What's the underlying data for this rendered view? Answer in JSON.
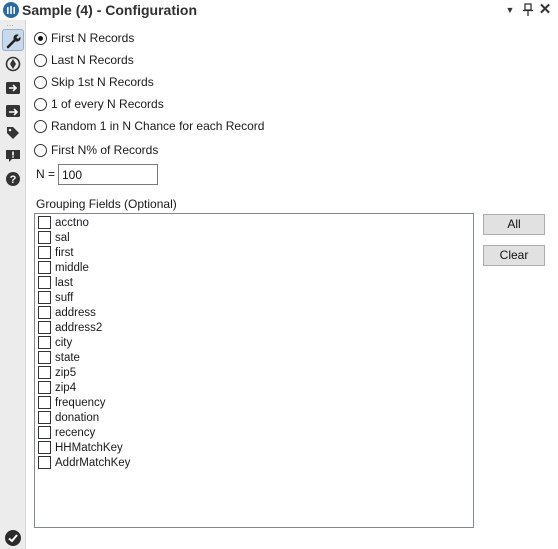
{
  "window": {
    "title": "Sample (4) - Configuration",
    "controls": {
      "dropdown": "▼",
      "pin": "📌",
      "close": "✕"
    }
  },
  "rail": {
    "icons": [
      "wrench-icon",
      "tool-navigate-icon",
      "input-arrow-icon",
      "output-arrow-icon",
      "tag-icon",
      "alert-icon",
      "help-icon"
    ],
    "status_icon": "checkmark-icon"
  },
  "sampling": {
    "options": [
      {
        "label": "First N Records",
        "checked": true
      },
      {
        "label": "Last N Records",
        "checked": false
      },
      {
        "label": "Skip 1st N Records",
        "checked": false
      },
      {
        "label": "1 of every N Records",
        "checked": false
      },
      {
        "label": "Random 1 in N Chance for each Record",
        "checked": false
      },
      {
        "label": "First N% of Records",
        "checked": false
      }
    ],
    "n_label": "N =",
    "n_value": "100"
  },
  "grouping": {
    "label": "Grouping Fields (Optional)",
    "fields": [
      {
        "name": "acctno",
        "checked": false
      },
      {
        "name": "sal",
        "checked": false
      },
      {
        "name": "first",
        "checked": false
      },
      {
        "name": "middle",
        "checked": false
      },
      {
        "name": "last",
        "checked": false
      },
      {
        "name": "suff",
        "checked": false
      },
      {
        "name": "address",
        "checked": false
      },
      {
        "name": "address2",
        "checked": false
      },
      {
        "name": "city",
        "checked": false
      },
      {
        "name": "state",
        "checked": false
      },
      {
        "name": "zip5",
        "checked": false
      },
      {
        "name": "zip4",
        "checked": false
      },
      {
        "name": "frequency",
        "checked": false
      },
      {
        "name": "donation",
        "checked": false
      },
      {
        "name": "recency",
        "checked": false
      },
      {
        "name": "HHMatchKey",
        "checked": false
      },
      {
        "name": "AddrMatchKey",
        "checked": false
      }
    ],
    "all_label": "All",
    "clear_label": "Clear"
  },
  "colors": {
    "accent": "#2c6aa0",
    "rail_background": "#ececec",
    "active_rail_button": "#c9d9ea",
    "button_face": "#e1e1e1"
  }
}
